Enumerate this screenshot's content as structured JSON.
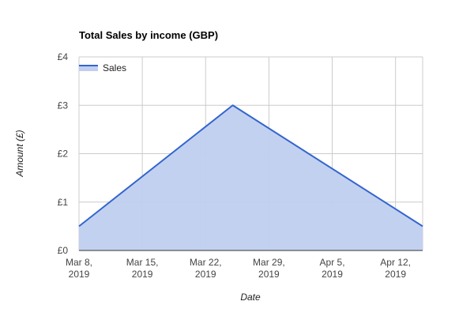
{
  "chart_data": {
    "type": "area",
    "title": "Total Sales by income (GBP)",
    "xlabel": "Date",
    "ylabel": "Amount (£)",
    "x": [
      "2019-03-08",
      "2019-03-25",
      "2019-04-15"
    ],
    "series": [
      {
        "name": "Sales",
        "values": [
          0.5,
          3.0,
          0.5
        ]
      }
    ],
    "xlim": [
      "2019-03-08",
      "2019-04-15"
    ],
    "ylim": [
      0,
      4
    ],
    "x_ticks": [
      {
        "date": "2019-03-08",
        "line1": "Mar 8,",
        "line2": "2019"
      },
      {
        "date": "2019-03-15",
        "line1": "Mar 15,",
        "line2": "2019"
      },
      {
        "date": "2019-03-22",
        "line1": "Mar 22,",
        "line2": "2019"
      },
      {
        "date": "2019-03-29",
        "line1": "Mar 29,",
        "line2": "2019"
      },
      {
        "date": "2019-04-05",
        "line1": "Apr 5,",
        "line2": "2019"
      },
      {
        "date": "2019-04-12",
        "line1": "Apr 12,",
        "line2": "2019"
      }
    ],
    "y_ticks": [
      {
        "value": 0,
        "label": "£0"
      },
      {
        "value": 1,
        "label": "£1"
      },
      {
        "value": 2,
        "label": "£2"
      },
      {
        "value": 3,
        "label": "£3"
      },
      {
        "value": 4,
        "label": "£4"
      }
    ],
    "grid": true,
    "legend_position": "top-left",
    "colors": {
      "line": "#3366cc",
      "fill": "#c0cff0",
      "grid": "#cccccc",
      "baseline": "#333333"
    }
  }
}
